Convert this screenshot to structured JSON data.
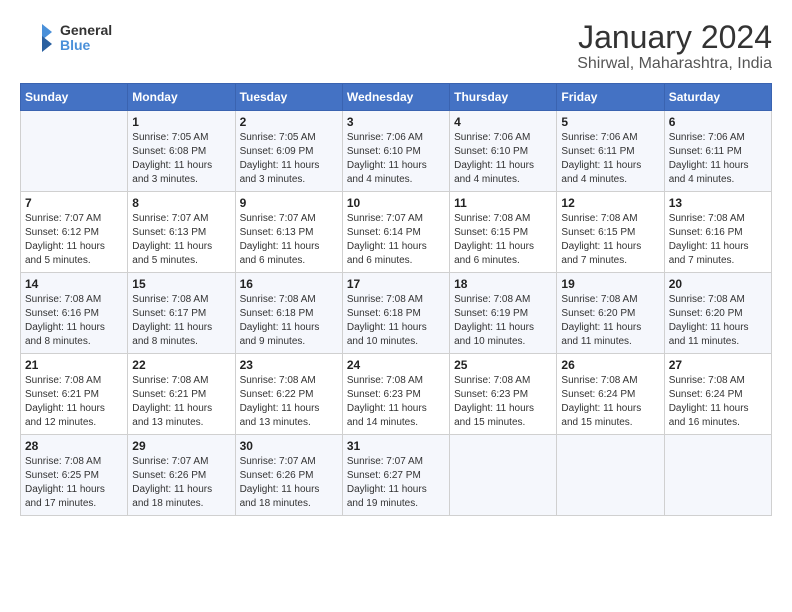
{
  "header": {
    "logo_line1": "General",
    "logo_line2": "Blue",
    "title": "January 2024",
    "subtitle": "Shirwal, Maharashtra, India"
  },
  "columns": [
    "Sunday",
    "Monday",
    "Tuesday",
    "Wednesday",
    "Thursday",
    "Friday",
    "Saturday"
  ],
  "weeks": [
    [
      {
        "day": "",
        "sunrise": "",
        "sunset": "",
        "daylight": ""
      },
      {
        "day": "1",
        "sunrise": "Sunrise: 7:05 AM",
        "sunset": "Sunset: 6:08 PM",
        "daylight": "Daylight: 11 hours and 3 minutes."
      },
      {
        "day": "2",
        "sunrise": "Sunrise: 7:05 AM",
        "sunset": "Sunset: 6:09 PM",
        "daylight": "Daylight: 11 hours and 3 minutes."
      },
      {
        "day": "3",
        "sunrise": "Sunrise: 7:06 AM",
        "sunset": "Sunset: 6:10 PM",
        "daylight": "Daylight: 11 hours and 4 minutes."
      },
      {
        "day": "4",
        "sunrise": "Sunrise: 7:06 AM",
        "sunset": "Sunset: 6:10 PM",
        "daylight": "Daylight: 11 hours and 4 minutes."
      },
      {
        "day": "5",
        "sunrise": "Sunrise: 7:06 AM",
        "sunset": "Sunset: 6:11 PM",
        "daylight": "Daylight: 11 hours and 4 minutes."
      },
      {
        "day": "6",
        "sunrise": "Sunrise: 7:06 AM",
        "sunset": "Sunset: 6:11 PM",
        "daylight": "Daylight: 11 hours and 4 minutes."
      }
    ],
    [
      {
        "day": "7",
        "sunrise": "Sunrise: 7:07 AM",
        "sunset": "Sunset: 6:12 PM",
        "daylight": "Daylight: 11 hours and 5 minutes."
      },
      {
        "day": "8",
        "sunrise": "Sunrise: 7:07 AM",
        "sunset": "Sunset: 6:13 PM",
        "daylight": "Daylight: 11 hours and 5 minutes."
      },
      {
        "day": "9",
        "sunrise": "Sunrise: 7:07 AM",
        "sunset": "Sunset: 6:13 PM",
        "daylight": "Daylight: 11 hours and 6 minutes."
      },
      {
        "day": "10",
        "sunrise": "Sunrise: 7:07 AM",
        "sunset": "Sunset: 6:14 PM",
        "daylight": "Daylight: 11 hours and 6 minutes."
      },
      {
        "day": "11",
        "sunrise": "Sunrise: 7:08 AM",
        "sunset": "Sunset: 6:15 PM",
        "daylight": "Daylight: 11 hours and 6 minutes."
      },
      {
        "day": "12",
        "sunrise": "Sunrise: 7:08 AM",
        "sunset": "Sunset: 6:15 PM",
        "daylight": "Daylight: 11 hours and 7 minutes."
      },
      {
        "day": "13",
        "sunrise": "Sunrise: 7:08 AM",
        "sunset": "Sunset: 6:16 PM",
        "daylight": "Daylight: 11 hours and 7 minutes."
      }
    ],
    [
      {
        "day": "14",
        "sunrise": "Sunrise: 7:08 AM",
        "sunset": "Sunset: 6:16 PM",
        "daylight": "Daylight: 11 hours and 8 minutes."
      },
      {
        "day": "15",
        "sunrise": "Sunrise: 7:08 AM",
        "sunset": "Sunset: 6:17 PM",
        "daylight": "Daylight: 11 hours and 8 minutes."
      },
      {
        "day": "16",
        "sunrise": "Sunrise: 7:08 AM",
        "sunset": "Sunset: 6:18 PM",
        "daylight": "Daylight: 11 hours and 9 minutes."
      },
      {
        "day": "17",
        "sunrise": "Sunrise: 7:08 AM",
        "sunset": "Sunset: 6:18 PM",
        "daylight": "Daylight: 11 hours and 10 minutes."
      },
      {
        "day": "18",
        "sunrise": "Sunrise: 7:08 AM",
        "sunset": "Sunset: 6:19 PM",
        "daylight": "Daylight: 11 hours and 10 minutes."
      },
      {
        "day": "19",
        "sunrise": "Sunrise: 7:08 AM",
        "sunset": "Sunset: 6:20 PM",
        "daylight": "Daylight: 11 hours and 11 minutes."
      },
      {
        "day": "20",
        "sunrise": "Sunrise: 7:08 AM",
        "sunset": "Sunset: 6:20 PM",
        "daylight": "Daylight: 11 hours and 11 minutes."
      }
    ],
    [
      {
        "day": "21",
        "sunrise": "Sunrise: 7:08 AM",
        "sunset": "Sunset: 6:21 PM",
        "daylight": "Daylight: 11 hours and 12 minutes."
      },
      {
        "day": "22",
        "sunrise": "Sunrise: 7:08 AM",
        "sunset": "Sunset: 6:21 PM",
        "daylight": "Daylight: 11 hours and 13 minutes."
      },
      {
        "day": "23",
        "sunrise": "Sunrise: 7:08 AM",
        "sunset": "Sunset: 6:22 PM",
        "daylight": "Daylight: 11 hours and 13 minutes."
      },
      {
        "day": "24",
        "sunrise": "Sunrise: 7:08 AM",
        "sunset": "Sunset: 6:23 PM",
        "daylight": "Daylight: 11 hours and 14 minutes."
      },
      {
        "day": "25",
        "sunrise": "Sunrise: 7:08 AM",
        "sunset": "Sunset: 6:23 PM",
        "daylight": "Daylight: 11 hours and 15 minutes."
      },
      {
        "day": "26",
        "sunrise": "Sunrise: 7:08 AM",
        "sunset": "Sunset: 6:24 PM",
        "daylight": "Daylight: 11 hours and 15 minutes."
      },
      {
        "day": "27",
        "sunrise": "Sunrise: 7:08 AM",
        "sunset": "Sunset: 6:24 PM",
        "daylight": "Daylight: 11 hours and 16 minutes."
      }
    ],
    [
      {
        "day": "28",
        "sunrise": "Sunrise: 7:08 AM",
        "sunset": "Sunset: 6:25 PM",
        "daylight": "Daylight: 11 hours and 17 minutes."
      },
      {
        "day": "29",
        "sunrise": "Sunrise: 7:07 AM",
        "sunset": "Sunset: 6:26 PM",
        "daylight": "Daylight: 11 hours and 18 minutes."
      },
      {
        "day": "30",
        "sunrise": "Sunrise: 7:07 AM",
        "sunset": "Sunset: 6:26 PM",
        "daylight": "Daylight: 11 hours and 18 minutes."
      },
      {
        "day": "31",
        "sunrise": "Sunrise: 7:07 AM",
        "sunset": "Sunset: 6:27 PM",
        "daylight": "Daylight: 11 hours and 19 minutes."
      },
      {
        "day": "",
        "sunrise": "",
        "sunset": "",
        "daylight": ""
      },
      {
        "day": "",
        "sunrise": "",
        "sunset": "",
        "daylight": ""
      },
      {
        "day": "",
        "sunrise": "",
        "sunset": "",
        "daylight": ""
      }
    ]
  ]
}
